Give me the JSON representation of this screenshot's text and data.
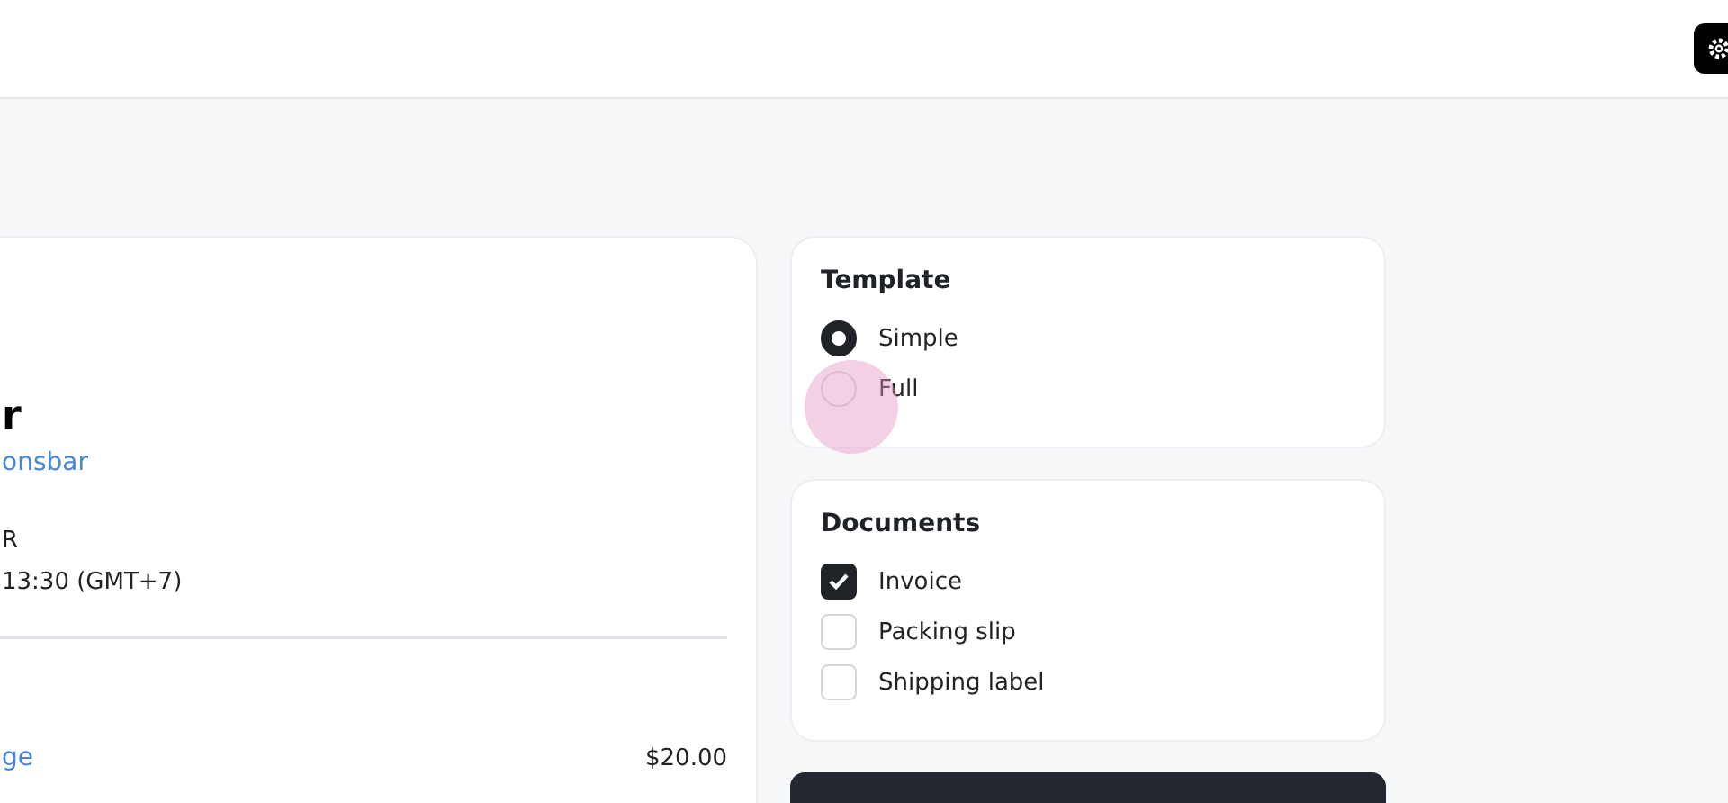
{
  "order": {
    "title": "r",
    "store_link": "onsbar",
    "line_1": "R",
    "line_2": "13:30 (GMT+7)",
    "item": {
      "name": "ge",
      "price": "$20.00"
    }
  },
  "template": {
    "title": "Template",
    "options": [
      {
        "label": "Simple",
        "selected": true
      },
      {
        "label": "Full",
        "selected": false
      }
    ]
  },
  "documents": {
    "title": "Documents",
    "items": [
      {
        "label": "Invoice",
        "checked": true
      },
      {
        "label": "Packing slip",
        "checked": false
      },
      {
        "label": "Shipping label",
        "checked": false
      }
    ]
  }
}
